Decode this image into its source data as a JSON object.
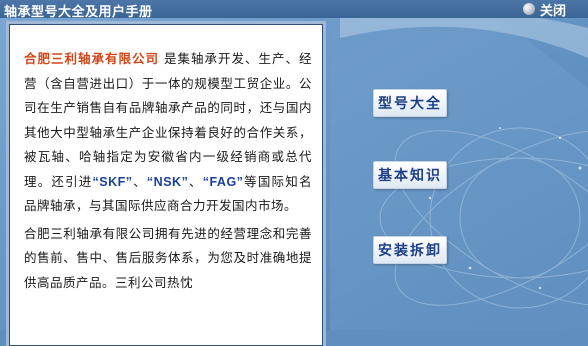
{
  "titlebar": {
    "title": "轴承型号大全及用户手册",
    "close_label": "关闭"
  },
  "content": {
    "company_name": "合肥三利轴承有限公司",
    "p1_rest_1": " 是集轴承开发、生产、经营（含自营进出口）于一体的规模型工贸企业。公司在生产销售自有品牌轴承产品的同时，还与国内其他大中型轴承生产企业保持着良好的合作关系，被瓦轴、哈轴指定为安徽省内一级经销商或总代理。还引进",
    "brand_skf": "“SKF”",
    "sep_1": "、",
    "brand_nsk": "“NSK”",
    "sep_2": "、",
    "brand_fag": "“FAG”",
    "p1_rest_2": "等国际知名品牌轴承，与其国际供应商合力开发国内市场。",
    "p2": "合肥三利轴承有限公司拥有先进的经营理念和完善的售前、售中、售后服务体系，为您及时准确地提供高品质产品。三利公司热忱"
  },
  "menu": {
    "models_label": "型号大全",
    "basics_label": "基本知识",
    "install_label": "安装拆卸"
  },
  "colors": {
    "background": "#5f8fbe",
    "company_name": "#d0461a",
    "brand": "#1b3fa0",
    "menu_text": "#1c3f86"
  }
}
